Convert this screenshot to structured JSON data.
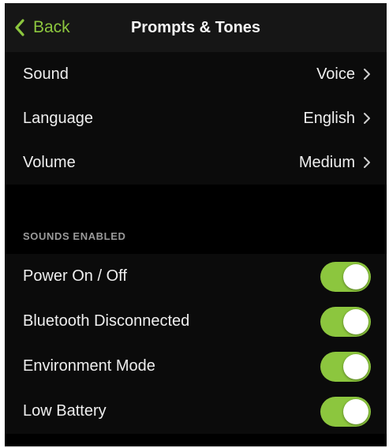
{
  "navbar": {
    "back_label": "Back",
    "title": "Prompts & Tones"
  },
  "settings": [
    {
      "label": "Sound",
      "value": "Voice"
    },
    {
      "label": "Language",
      "value": "English"
    },
    {
      "label": "Volume",
      "value": "Medium"
    }
  ],
  "sounds_enabled": {
    "header": "SOUNDS ENABLED",
    "items": [
      {
        "label": "Power On / Off",
        "enabled": true
      },
      {
        "label": "Bluetooth Disconnected",
        "enabled": true
      },
      {
        "label": "Environment Mode",
        "enabled": true
      },
      {
        "label": "Low Battery",
        "enabled": true
      }
    ]
  },
  "colors": {
    "accent": "#8cc63e",
    "background": "#000000",
    "navbar": "#161616",
    "text": "#efefef",
    "section_header": "#9a9a9a"
  },
  "icons": {
    "back": "chevron-left-icon",
    "disclosure": "chevron-right-icon"
  }
}
